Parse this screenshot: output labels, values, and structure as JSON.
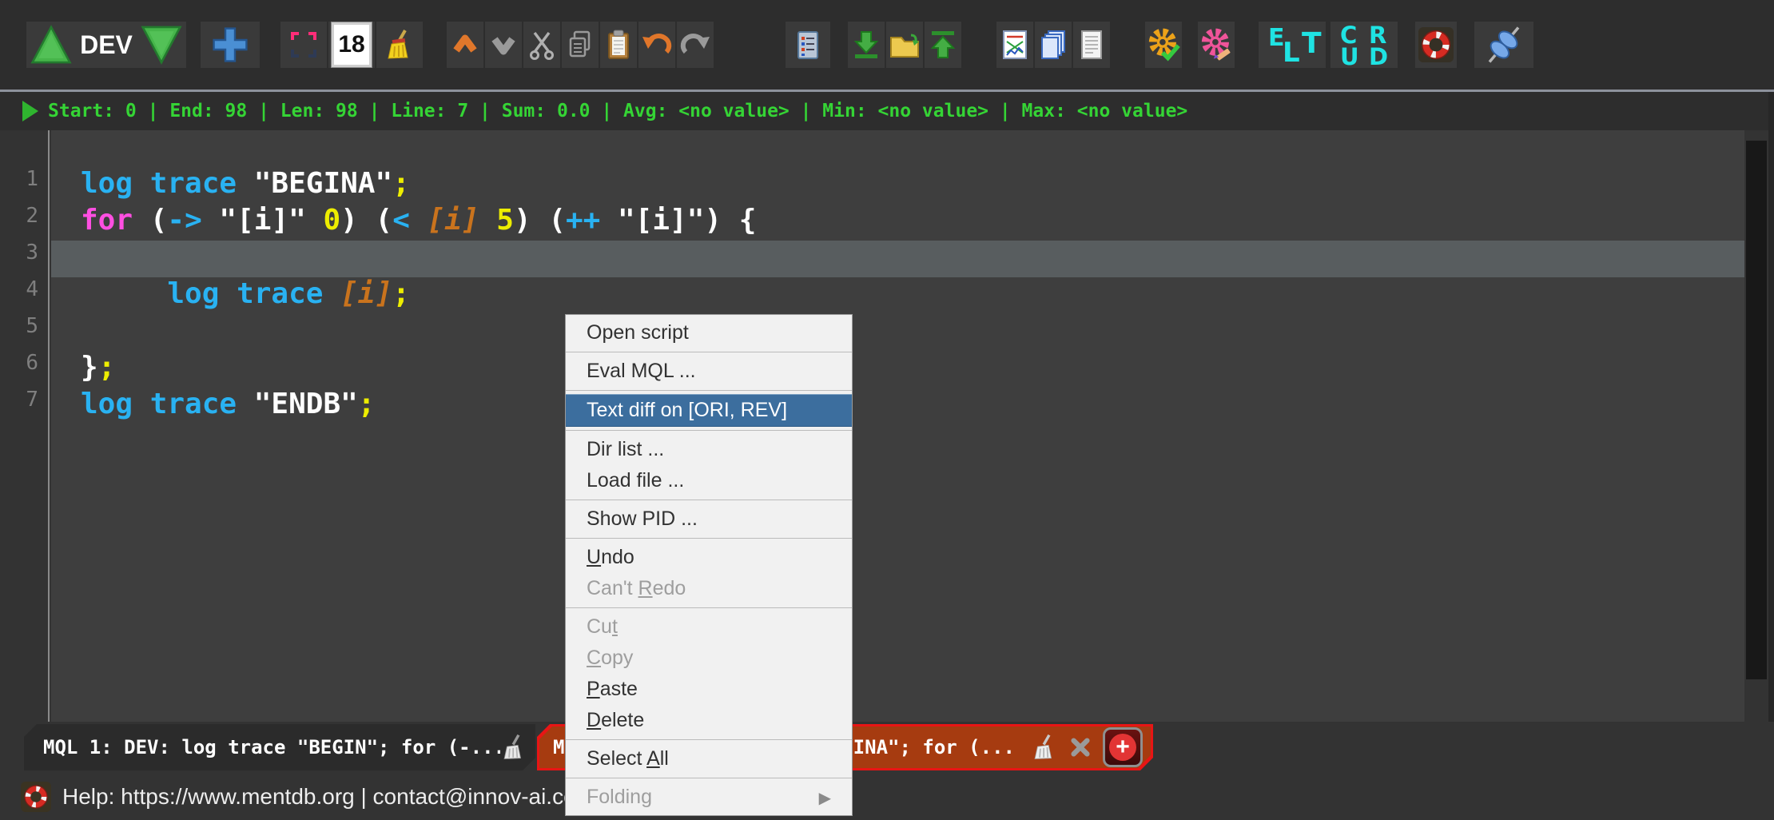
{
  "toolbar": {
    "env_label": "DEV",
    "font_size": "18",
    "elt_letters": [
      "E",
      "L",
      "T"
    ],
    "crud_letters": [
      "C",
      "R",
      "U",
      "D"
    ],
    "button_icons": [
      "run-up-triangle",
      "run-down-triangle",
      "new-plus",
      "selection-frame",
      "font-size-box",
      "clean-broom",
      "chevron-up",
      "chevron-down",
      "scissors",
      "copy",
      "paste",
      "undo",
      "redo",
      "task-list-document",
      "import-green-down-arrow",
      "folder",
      "export-green-up-arrow",
      "chart-page",
      "blue-pages",
      "white-document",
      "gear-check",
      "gear-edit",
      "elt",
      "crud",
      "lifebuoy",
      "connector-plug"
    ]
  },
  "statusbar": {
    "text": "Start: 0 | End: 98 | Len: 98 | Line: 7 | Sum: 0.0 | Avg: <no value> | Min: <no value> | Max: <no value>"
  },
  "editor": {
    "lines": [
      {
        "num": 1,
        "tokens": [
          [
            "kw",
            "log trace "
          ],
          [
            "str",
            "\"BEGINA\""
          ],
          [
            "semi",
            ";"
          ]
        ]
      },
      {
        "num": 2,
        "tokens": [
          [
            "flow",
            "for "
          ],
          [
            "plain",
            "("
          ],
          [
            "op",
            "->"
          ],
          [
            "plain",
            " \"[i]\" "
          ],
          [
            "num",
            "0"
          ],
          [
            "plain",
            ") ("
          ],
          [
            "op",
            "<"
          ],
          [
            "plain",
            " "
          ],
          [
            "var",
            "[i]"
          ],
          [
            "plain",
            " "
          ],
          [
            "num",
            "5"
          ],
          [
            "plain",
            ") ("
          ],
          [
            "op",
            "++"
          ],
          [
            "plain",
            " \"[i]\") {"
          ]
        ]
      },
      {
        "num": 3,
        "highlight": true,
        "tokens": []
      },
      {
        "num": 4,
        "tokens": [
          [
            "plain",
            "     "
          ],
          [
            "kw",
            "log trace "
          ],
          [
            "var",
            "[i]"
          ],
          [
            "semi",
            ";"
          ]
        ]
      },
      {
        "num": 5,
        "tokens": []
      },
      {
        "num": 6,
        "tokens": [
          [
            "plain",
            "}"
          ],
          [
            "semi",
            ";"
          ]
        ]
      },
      {
        "num": 7,
        "tokens": [
          [
            "kw",
            "log trace "
          ],
          [
            "str",
            "\"ENDB\""
          ],
          [
            "semi",
            ";"
          ]
        ]
      }
    ]
  },
  "context_menu": {
    "groups": [
      {
        "items": [
          {
            "label": "Open script"
          }
        ]
      },
      {
        "items": [
          {
            "label": "Eval MQL ..."
          }
        ]
      },
      {
        "items": [
          {
            "label": "Text diff on [ORI, REV]",
            "selected": true
          }
        ]
      },
      {
        "items": [
          {
            "label": "Dir list ..."
          },
          {
            "label": "Load file ..."
          }
        ]
      },
      {
        "items": [
          {
            "label": "Show PID ..."
          }
        ]
      },
      {
        "items": [
          {
            "label": "Undo",
            "mnemonic": "U"
          },
          {
            "label": "Can't Redo",
            "mnemonic": "R",
            "disabled": true
          }
        ]
      },
      {
        "items": [
          {
            "label": "Cut",
            "mnemonic": "t",
            "disabled": true
          },
          {
            "label": "Copy",
            "mnemonic": "C",
            "disabled": true
          },
          {
            "label": "Paste",
            "mnemonic": "P"
          },
          {
            "label": "Delete",
            "mnemonic": "D"
          }
        ]
      },
      {
        "items": [
          {
            "label": "Select All",
            "mnemonic": "A"
          }
        ]
      },
      {
        "items": [
          {
            "label": "Folding",
            "disabled": true,
            "submenu": true
          }
        ]
      }
    ]
  },
  "tabs": [
    {
      "label": "MQL 1: DEV: log trace \"BEGIN\"; for (-...",
      "active": false
    },
    {
      "label": "MQL 2: DEV: log trace \"BEGINA\"; for (...",
      "active": true
    }
  ],
  "help_bar": {
    "text": "Help: https://www.mentdb.org | contact@innov-ai.com"
  },
  "icons": {
    "submenu-arrow": "▶",
    "add-plus": "+"
  },
  "colors": {
    "keyword": "#29b2f2",
    "flow": "#ff4fe1",
    "number": "#eded00",
    "variable": "#c9731d",
    "string": "#ffffff",
    "status_green": "#35d435",
    "tab_active_bg": "#a63b10",
    "tab_active_border": "#e81515",
    "menu_selected": "#3c6e9e"
  }
}
